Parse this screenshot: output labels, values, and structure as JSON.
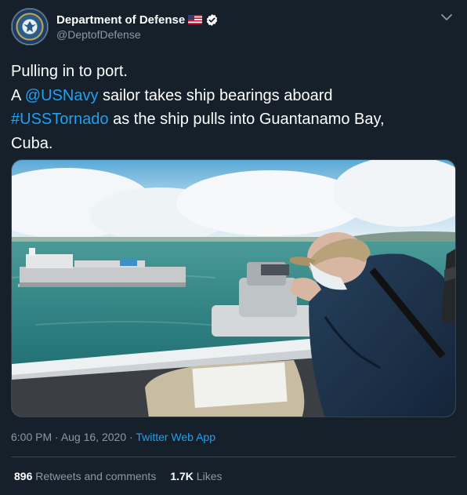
{
  "account": {
    "display_name": "Department of Defense",
    "handle": "@DeptofDefense",
    "verified": true,
    "avatar_icon": "dod-seal-icon",
    "flag_icon": "us-flag-icon"
  },
  "tweet": {
    "line1": "Pulling in to port.",
    "line2_prefix": "A ",
    "mention": "@USNavy",
    "line2_suffix": " sailor takes ship bearings aboard",
    "hashtag": "#USSTornado",
    "line3_suffix": " as the ship pulls into Guantanamo Bay,",
    "line4": "Cuba.",
    "image_subject": "sailor-taking-bearings-photo"
  },
  "meta": {
    "time": "6:00 PM",
    "sep1": " · ",
    "date": "Aug 16, 2020",
    "sep2": " · ",
    "app": "Twitter Web App"
  },
  "stats": {
    "retweets_count": "896",
    "retweets_label": "Retweets and comments",
    "likes_count": "1.7K",
    "likes_label": "Likes"
  },
  "colors": {
    "background": "#15202b",
    "link": "#1da1f2",
    "secondary_text": "#8899a6",
    "divider": "#38444d"
  }
}
